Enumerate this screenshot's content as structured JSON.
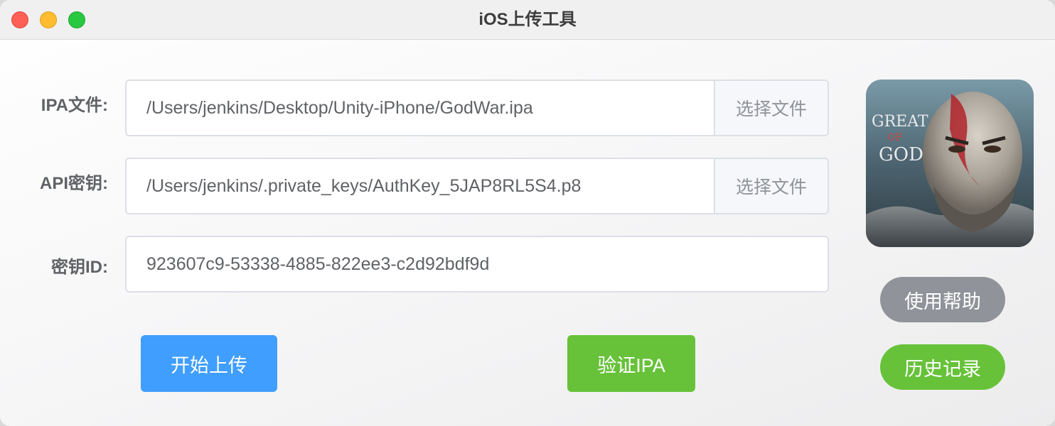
{
  "window": {
    "title": "iOS上传工具"
  },
  "form": {
    "ipa_label": "IPA文件:",
    "ipa_value": "/Users/jenkins/Desktop/Unity-iPhone/GodWar.ipa",
    "ipa_button": "选择文件",
    "api_label": "API密钥:",
    "api_value": "/Users/jenkins/.private_keys/AuthKey_5JAP8RL5S4.p8",
    "api_button": "选择文件",
    "keyid_label": "密钥ID:",
    "keyid_value": "923607c9-53338-4885-822ee3-c2d92bdf9d"
  },
  "actions": {
    "upload": "开始上传",
    "verify": "验证IPA"
  },
  "side": {
    "app_icon_text_1": "GREAT",
    "app_icon_text_2": "OF",
    "app_icon_text_3": "GOD",
    "help": "使用帮助",
    "history": "历史记录"
  },
  "colors": {
    "primary": "#409eff",
    "success": "#67c23a",
    "info": "#909399"
  }
}
